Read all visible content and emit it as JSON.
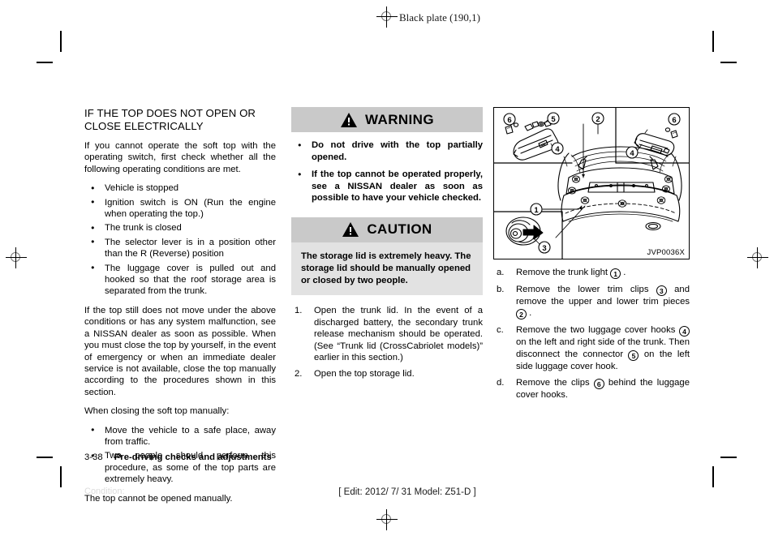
{
  "header": {
    "plate": "Black plate (190,1)"
  },
  "footer": {
    "page_number": "3-38",
    "section": "Pre-driving checks and adjustments",
    "edit_line": "[ Edit: 2012/ 7/ 31   Model: Z51-D ]",
    "condition": "Condition:"
  },
  "left_column": {
    "title": "IF THE TOP DOES NOT OPEN OR CLOSE ELECTRICALLY",
    "intro": "If you cannot operate the soft top with the operating switch, first check whether all the following operating conditions are met.",
    "conditions": [
      "Vehicle is stopped",
      "Ignition switch is ON (Run the engine when operating the top.)",
      "The trunk is closed",
      "The selector lever is in a position other than the R (Reverse) position",
      "The luggage cover is pulled out and hooked so that the roof storage area is separated from the trunk."
    ],
    "paragraph2": "If the top still does not move under the above conditions or has any system malfunction, see a NISSAN dealer as soon as possible. When you must close the top by yourself, in the event of emergency or when an immediate dealer service is not available, close the top manually according to the procedures shown in this section.",
    "paragraph3": "When closing the soft top manually:",
    "manual_notes": [
      "Move the vehicle to a safe place, away from traffic.",
      "Two people should perform this procedure, as some of the top parts are extremely heavy."
    ],
    "paragraph4": "The top cannot be opened manually."
  },
  "middle_column": {
    "warning": {
      "label": "WARNING",
      "icon": "warning-triangle-icon",
      "items": [
        "Do not drive with the top partially opened.",
        "If the top cannot be operated properly, see a NISSAN dealer as soon as possible to have your vehicle checked."
      ]
    },
    "caution": {
      "label": "CAUTION",
      "icon": "warning-triangle-icon",
      "text": "The storage lid is extremely heavy. The storage lid should be manually opened or closed by two people."
    },
    "steps": [
      {
        "marker": "1.",
        "text": "Open the trunk lid. In the event of a discharged battery, the secondary trunk release mechanism should be operated. (See “Trunk lid (CrossCabriolet models)” earlier in this section.)"
      },
      {
        "marker": "2.",
        "text": "Open the top storage lid."
      }
    ]
  },
  "right_column": {
    "figure": {
      "caption": "JVP0036X",
      "callouts": [
        "1",
        "2",
        "3",
        "4",
        "5",
        "6"
      ]
    },
    "steps": [
      {
        "marker": "a.",
        "parts": [
          "Remove the trunk light ",
          "1",
          " ."
        ]
      },
      {
        "marker": "b.",
        "parts": [
          "Remove the lower trim clips ",
          "3",
          " and remove the upper and lower trim pieces ",
          "2",
          " ."
        ]
      },
      {
        "marker": "c.",
        "parts": [
          "Remove the two luggage cover hooks ",
          "4",
          " on the left and right side of the trunk. Then disconnect the connector ",
          "5",
          " on the left side luggage cover hook."
        ]
      },
      {
        "marker": "d.",
        "parts": [
          "Remove the clips ",
          "6",
          " behind the luggage cover hooks."
        ]
      }
    ]
  },
  "colors": {
    "alert_header_bg": "#c9c9c9",
    "caution_body_bg": "#e2e2e2",
    "text": "#000000"
  }
}
